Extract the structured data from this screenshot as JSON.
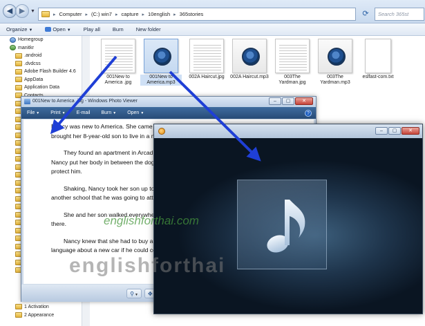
{
  "explorer": {
    "breadcrumb": [
      "Computer",
      "(C:) win7",
      "capture",
      "10english",
      "365stories"
    ],
    "search_placeholder": "Search 365st",
    "toolbar": {
      "organize": "Organize",
      "open": "Open",
      "play_all": "Play all",
      "burn": "Burn",
      "new_folder": "New folder"
    },
    "nav_items": [
      {
        "label": "Homegroup",
        "icon": "homegroup-icon"
      },
      {
        "label": "manitkr",
        "icon": "user-icon"
      },
      {
        "label": ".android",
        "icon": "folder-icon"
      },
      {
        "label": ".dvdcss",
        "icon": "folder-icon"
      },
      {
        "label": "Adobe Flash Builder 4.6",
        "icon": "folder-icon"
      },
      {
        "label": "AppData",
        "icon": "folder-icon"
      },
      {
        "label": "Application Data",
        "icon": "folder-icon"
      },
      {
        "label": "Contacts",
        "icon": "folder-icon"
      }
    ],
    "files": [
      {
        "name": "001New to America .jpg",
        "kind": "doc"
      },
      {
        "name": "001New to America.mp3",
        "kind": "rp",
        "selected": true
      },
      {
        "name": "002A Haircut.jpg",
        "kind": "doc"
      },
      {
        "name": "002A Haircut.mp3",
        "kind": "rp"
      },
      {
        "name": "003The Yardman.jpg",
        "kind": "doc"
      },
      {
        "name": "003The Yardman.mp3",
        "kind": "rp"
      },
      {
        "name": "eslfast-com.txt",
        "kind": "txt"
      }
    ],
    "lower_items": [
      "1 Activation",
      "2 Appearance"
    ]
  },
  "viewer": {
    "title": "001New to America .jpg - Windows Photo Viewer",
    "menu": {
      "file": "File",
      "print": "Print",
      "email": "E-mail",
      "burn": "Burn",
      "open": "Open"
    },
    "paragraphs": [
      "Nancy was new to America. She came to America speaking only her native language. She brought her 8-year-old son to live in a new world.",
      "They found an apartment in Arcadia. One day a neighbor's dog jumped over the fence. Nancy put her body in between the dog and her son, screaming at it. She was going to protect him.",
      "Shaking, Nancy took her son up to the apartment for the weekend. Then Nancy found another school that he was going to attend.",
      "She and her son walked everywhere together. He had an asthma attack. All the way there.",
      "Nancy knew that she had to buy a car. She talked to a salesman who spoke her language about a new car if he could come over to pick her up right over."
    ],
    "controls": {
      "zoom": "⚲",
      "fit": "✥",
      "prev": "⏮"
    }
  },
  "player": {
    "icon": "music-note-icon",
    "buttons": [
      "–",
      "▢",
      "✕"
    ]
  },
  "watermarks": {
    "green": "englishforthai.com",
    "gray": "englishforthai"
  },
  "colors": {
    "arrow": "#1f3fd6",
    "accent": "#284c78"
  }
}
